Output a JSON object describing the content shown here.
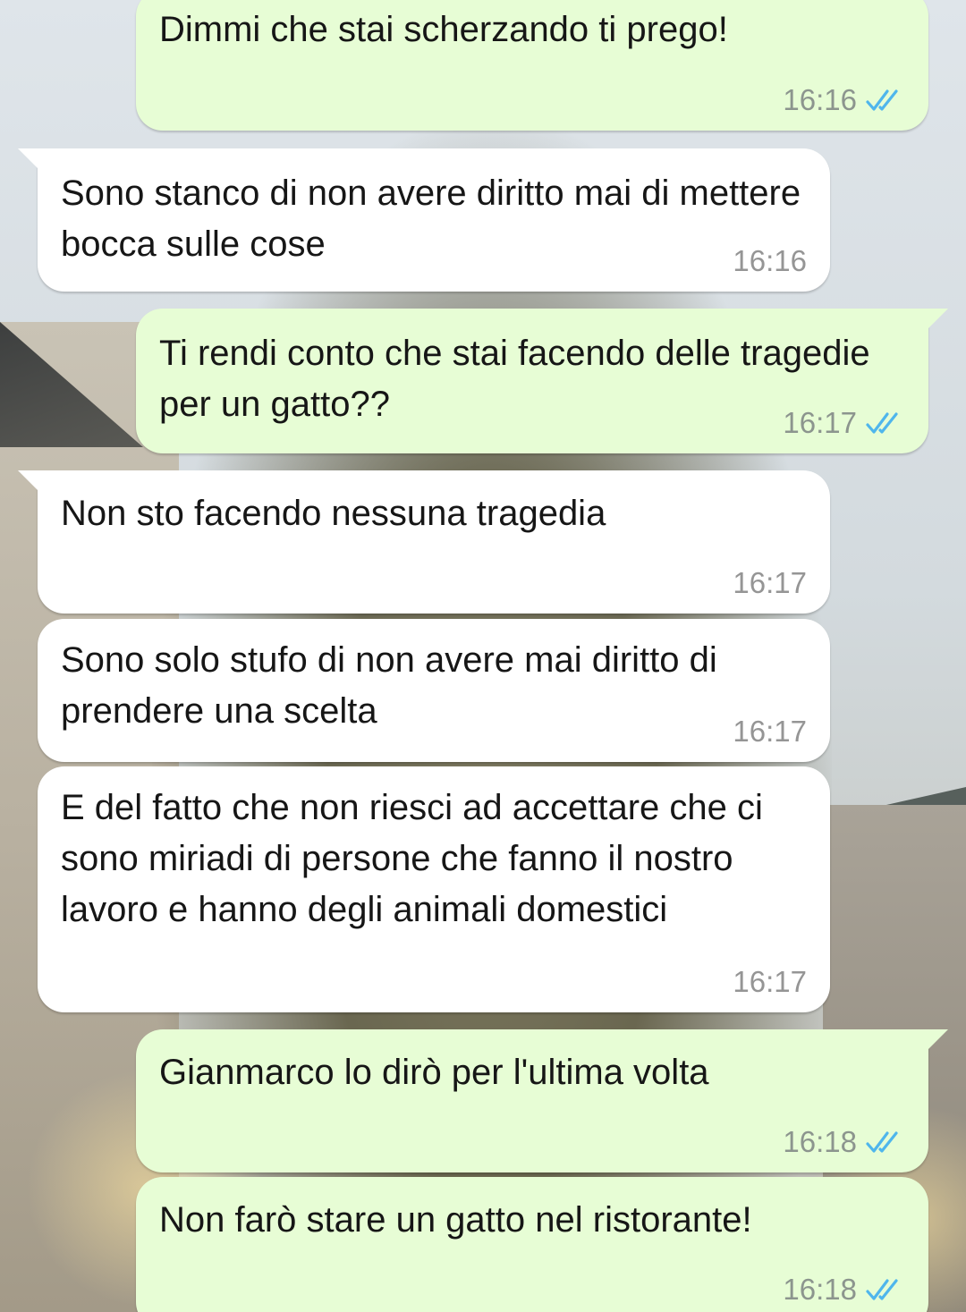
{
  "messages": [
    {
      "direction": "outgoing",
      "text": "Dimmi che stai scherzando ti prego!",
      "time": "16:16",
      "status_icon": "double-check-read-icon"
    },
    {
      "direction": "incoming",
      "text": "Sono stanco di non avere diritto mai di mettere bocca sulle cose",
      "time": "16:16"
    },
    {
      "direction": "outgoing",
      "text": "Ti rendi conto che stai facendo delle tragedie per un gatto??",
      "time": "16:17",
      "status_icon": "double-check-read-icon"
    },
    {
      "direction": "incoming",
      "text": "Non sto facendo nessuna tragedia",
      "time": "16:17"
    },
    {
      "direction": "incoming",
      "text": "Sono solo stufo di non avere mai diritto di prendere una scelta",
      "time": "16:17"
    },
    {
      "direction": "incoming",
      "text": "E del fatto che non riesci ad accettare che ci sono miriadi di persone che fanno il nostro lavoro e hanno degli animali domestici",
      "time": "16:17"
    },
    {
      "direction": "outgoing",
      "text": "Gianmarco lo dirò per l'ultima volta",
      "time": "16:18",
      "status_icon": "double-check-read-icon"
    },
    {
      "direction": "outgoing",
      "text": "Non farò stare un gatto nel ristorante!",
      "time": "16:18",
      "status_icon": "double-check-read-icon"
    }
  ],
  "colors": {
    "outgoing_bubble": "#e7fdd5",
    "incoming_bubble": "#ffffff",
    "read_tick": "#4fb6ec",
    "text": "#161616",
    "time": "#8c958e"
  }
}
